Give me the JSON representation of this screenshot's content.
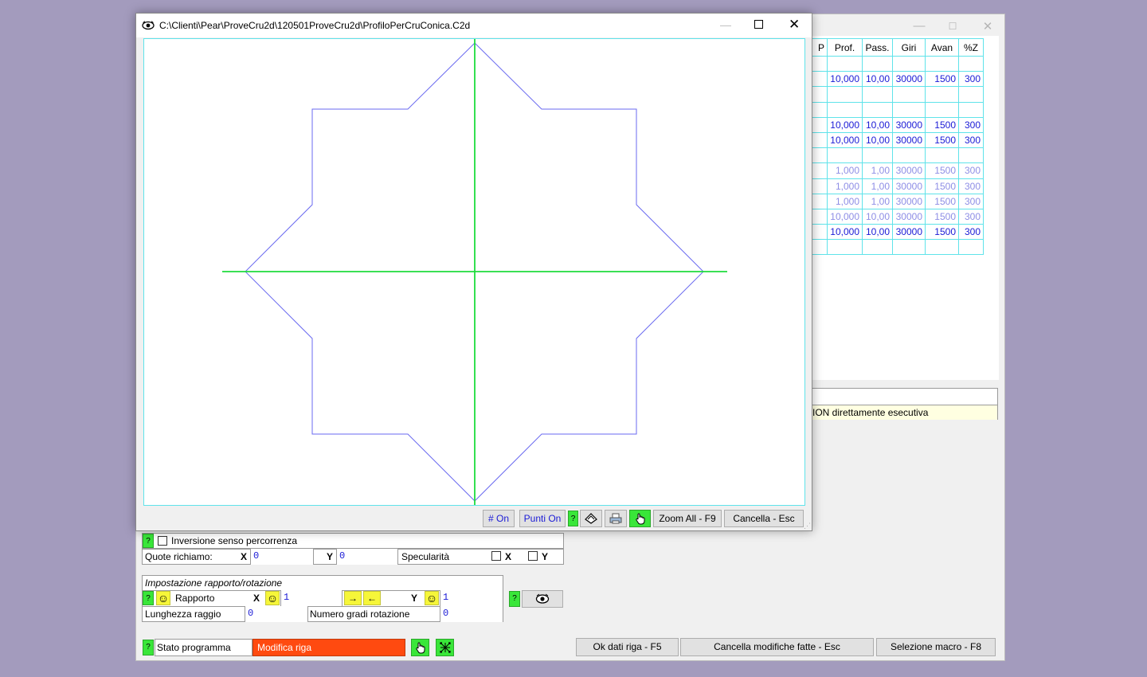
{
  "main_window": {
    "table": {
      "headers": [
        "P",
        "Prof.",
        "Pass.",
        "Giri",
        "Avan",
        "%Z"
      ],
      "rows": [
        {
          "state": "empty",
          "cells": [
            "",
            "",
            "",
            "",
            "",
            ""
          ]
        },
        {
          "state": "active",
          "cells": [
            "",
            "10,000",
            "10,00",
            "30000",
            "1500",
            "300"
          ]
        },
        {
          "state": "empty",
          "cells": [
            "",
            "",
            "",
            "",
            "",
            ""
          ]
        },
        {
          "state": "empty",
          "cells": [
            "",
            "",
            "",
            "",
            "",
            ""
          ]
        },
        {
          "state": "active",
          "cells": [
            "",
            "10,000",
            "10,00",
            "30000",
            "1500",
            "300"
          ]
        },
        {
          "state": "active",
          "cells": [
            "",
            "10,000",
            "10,00",
            "30000",
            "1500",
            "300"
          ]
        },
        {
          "state": "empty",
          "cells": [
            "",
            "",
            "",
            "",
            "",
            ""
          ]
        },
        {
          "state": "dim",
          "cells": [
            "",
            "1,000",
            "1,00",
            "30000",
            "1500",
            "300"
          ]
        },
        {
          "state": "dim",
          "cells": [
            "",
            "1,000",
            "1,00",
            "30000",
            "1500",
            "300"
          ]
        },
        {
          "state": "dim",
          "cells": [
            "",
            "1,000",
            "1,00",
            "30000",
            "1500",
            "300"
          ]
        },
        {
          "state": "dim",
          "cells": [
            "",
            "10,000",
            "10,00",
            "30000",
            "1500",
            "300"
          ]
        },
        {
          "state": "active",
          "cells": [
            "",
            "10,000",
            "10,00",
            "30000",
            "1500",
            "300"
          ]
        },
        {
          "state": "empty",
          "cells": [
            "",
            "",
            "",
            "",
            "",
            ""
          ]
        }
      ]
    },
    "message_line": "ION direttamente esecutiva",
    "inversione_label": "Inversione senso percorrenza",
    "quote": {
      "label": "Quote richiamo:",
      "x_label": "X",
      "x_value": "0",
      "y_label": "Y",
      "y_value": "0",
      "specularita_label": "Specularità",
      "spec_x_label": "X",
      "spec_y_label": "Y"
    },
    "rapporto": {
      "section_title": "Impostazione rapporto/rotazione",
      "rapporto_label": "Rapporto",
      "x_label": "X",
      "x_value": "1",
      "arrow_right": "→",
      "arrow_left": "←",
      "y_label": "Y",
      "y_value": "1",
      "raggio_label": "Lunghezza raggio",
      "raggio_value": "0",
      "gradi_label": "Numero gradi rotazione",
      "gradi_value": "0"
    },
    "help_mark": "?",
    "smile_glyph": "☺",
    "stato": {
      "label": "Stato programma",
      "value": "Modifica riga"
    },
    "buttons": {
      "ok": "Ok dati riga - F5",
      "cancel_changes": "Cancella modifiche fatte - Esc",
      "macro": "Selezione macro - F8"
    },
    "icons": [
      "eye-icon",
      "hand-pointer-icon",
      "shrink-icon"
    ]
  },
  "preview_window": {
    "title": "C:\\Clienti\\Pear\\ProveCru2d\\120501ProveCru2d\\ProfiloPerCruConica.C2d",
    "toolbar": {
      "grid_toggle": "# On",
      "points_toggle": "Punti On",
      "help": "?",
      "zoom_all": "Zoom All - F9",
      "cancel": "Cancella - Esc"
    },
    "colors": {
      "profile": "#6a6af0",
      "axes": "#1edc3c",
      "grid_border": "#5fe3ea",
      "status_red": "#ff4a10"
    }
  }
}
